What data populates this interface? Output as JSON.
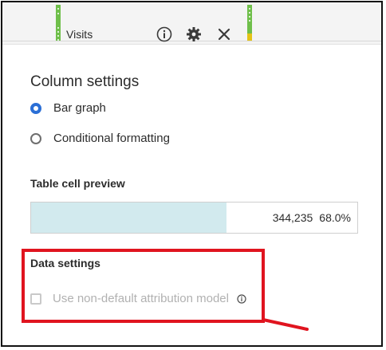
{
  "header": {
    "column_label": "Visits",
    "icons": [
      "info-icon",
      "gear-icon",
      "close-icon"
    ]
  },
  "panel": {
    "title": "Column settings",
    "radio_options": [
      {
        "label": "Bar graph",
        "selected": true
      },
      {
        "label": "Conditional formatting",
        "selected": false
      }
    ],
    "preview": {
      "title": "Table cell preview",
      "value": "344,235",
      "percent": "68.0%",
      "bar_fraction": 0.6
    },
    "data_settings": {
      "title": "Data settings",
      "checkbox_label": "Use non-default attribution model",
      "checked": false,
      "disabled": true
    }
  },
  "colors": {
    "accent": "#2b6fd6",
    "bar_fill": "#d2eaee",
    "highlight": "#e0141f",
    "drag_strip": "#6fbf4a"
  }
}
